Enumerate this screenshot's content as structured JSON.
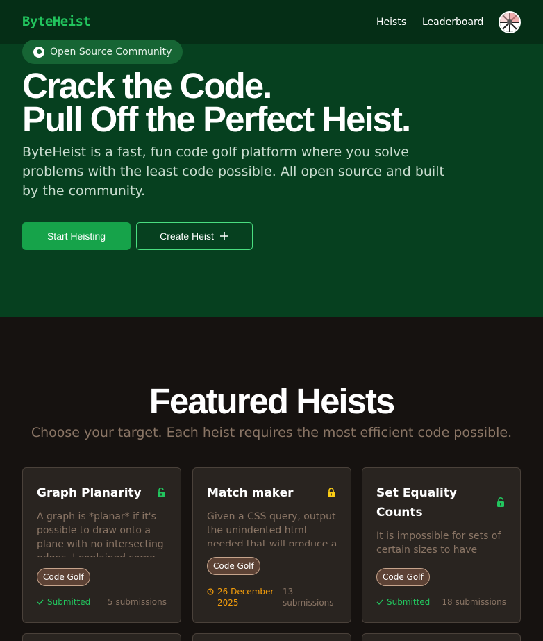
{
  "nav": {
    "logo": "ByteHeist",
    "links": [
      "Heists",
      "Leaderboard"
    ]
  },
  "hero": {
    "badge": "Open Source Community",
    "title_line1": "Crack the Code.",
    "title_line2": "Pull Off the Perfect Heist.",
    "description": "ByteHeist is a fast, fun code golf platform where you solve problems with the least code possible. All open source and built by the community.",
    "primary_button": "Start Heisting",
    "secondary_button": "Create Heist",
    "secondary_icon": "plus-icon"
  },
  "featured": {
    "title": "Featured Heists",
    "subtitle": "Choose your target. Each heist requires the most efficient code possible.",
    "cards": [
      {
        "title": "Graph Planarity",
        "lock_icon": "unlocked-icon",
        "description": "A graph is *planar* if it's possible to draw onto a plane with no intersecting edges. I explained some",
        "tag": "Code Golf",
        "status": "Submitted",
        "submissions": "5 submissions"
      },
      {
        "title": "Match maker",
        "lock_icon": "locked-icon",
        "description": "Given a CSS query, output the unindented html needed that will produce a",
        "tag": "Code Golf",
        "deadline": "26 December 2025",
        "submissions": "13 submissions"
      },
      {
        "title": "Set Equality Counts",
        "lock_icon": "unlocked-icon",
        "description": "It is impossible for sets of certain sizes to have certain",
        "tag": "Code Golf",
        "status": "Submitted",
        "submissions": "18 submissions"
      }
    ]
  },
  "colors": {
    "hero_bg": "#06401f",
    "nav_bg": "#052e16",
    "accent": "#16a34a",
    "logo": "#22c55e",
    "page_bg": "#161210",
    "card_bg": "#292420",
    "muted": "#8a7565",
    "lock_gold": "#facc15",
    "deadline": "#f59e0b"
  }
}
